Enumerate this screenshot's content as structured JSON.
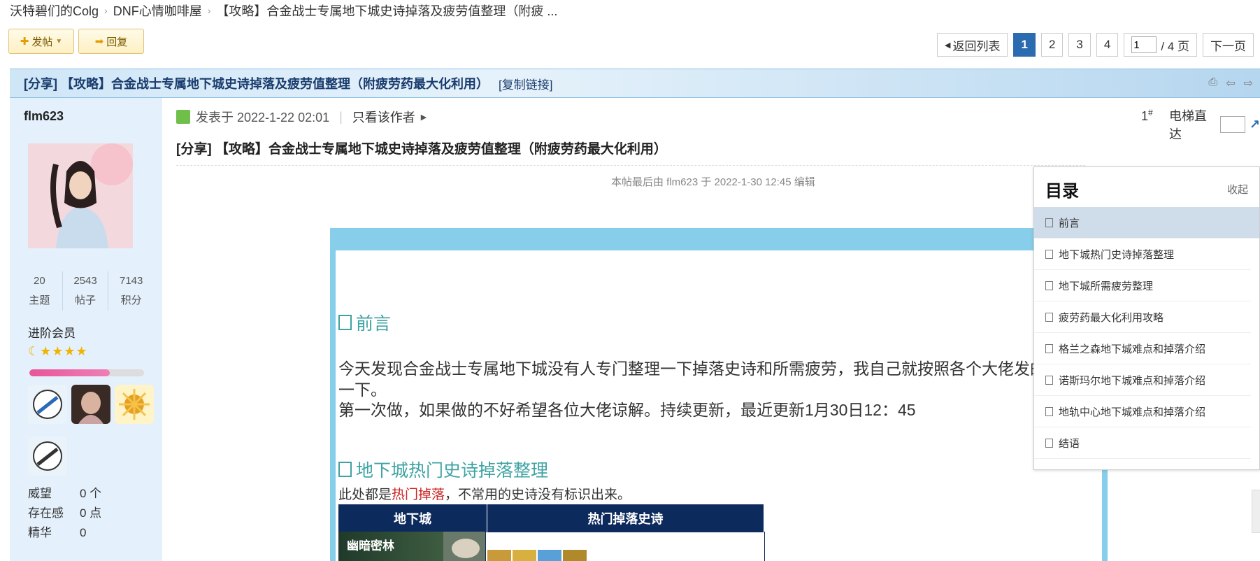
{
  "breadcrumb": {
    "items": [
      "沃特碧们的Colg",
      "DNF心情咖啡屋",
      "【攻略】合金战士专属地下城史诗掉落及疲劳值整理（附疲 ..."
    ]
  },
  "actions": {
    "post_label": "发帖",
    "reply_label": "回复"
  },
  "pager": {
    "back_label": "返回列表",
    "pages": [
      "1",
      "2",
      "3",
      "4"
    ],
    "current": "1",
    "jump_value": "1",
    "total_label": "/ 4 页",
    "next_label": "下一页"
  },
  "thread": {
    "title": "[分享] 【攻略】合金战士专属地下城史诗掉落及疲劳值整理（附疲劳药最大化利用）",
    "copy_link": "[复制链接]"
  },
  "user": {
    "name": "flm623",
    "stats": [
      {
        "value": "20",
        "label": "主题"
      },
      {
        "value": "2543",
        "label": "帖子"
      },
      {
        "value": "7143",
        "label": "积分"
      }
    ],
    "level": "进阶会员",
    "stars": "☾★★★★",
    "xp_fraction": 0.7,
    "props": [
      {
        "key": "威望",
        "value": "0 个"
      },
      {
        "key": "存在感",
        "value": "0 点"
      },
      {
        "key": "精华",
        "value": "0"
      }
    ]
  },
  "post": {
    "posted_at": "发表于 2022-1-22 02:01",
    "only_author": "只看该作者",
    "floor": "1",
    "floor_mark": "#",
    "elevator_label": "电梯直达",
    "title": "[分享] 【攻略】合金战士专属地下城史诗掉落及疲劳值整理（附疲劳药最大化利用）",
    "edit_note": "本帖最后由 flm623 于 2022-1-30 12:45 编辑",
    "section1_title": "前言",
    "para1": "今天发现合金战士专属地下城没有人专门整理一下掉落史诗和所需疲劳，我自己就按照各个大佬发的帖",
    "para1b": "一下。",
    "para2": "第一次做，如果做的不好希望各位大佬谅解。持续更新，最近更新1月30日12：45",
    "section2_title": "地下城热门史诗掉落整理",
    "note_prefix": "此处都是",
    "note_red": "热门掉落",
    "note_suffix": "，不常用的史诗没有标识出来。",
    "table_headers": [
      "地下城",
      "热门掉落史诗"
    ],
    "first_dungeon": "幽暗密林"
  },
  "toc": {
    "title": "目录",
    "collapse": "收起",
    "items": [
      "前言",
      "地下城热门史诗掉落整理",
      "地下城所需疲劳整理",
      "疲劳药最大化利用攻略",
      "格兰之森地下城难点和掉落介绍",
      "诺斯玛尔地下城难点和掉落介绍",
      "地轨中心地下城难点和掉落介绍",
      "结语"
    ]
  },
  "colors": {
    "accent": "#2b6cb0",
    "heading": "#3fa3a3",
    "frame": "#87ceeb",
    "table_header": "#0d2a5c"
  }
}
